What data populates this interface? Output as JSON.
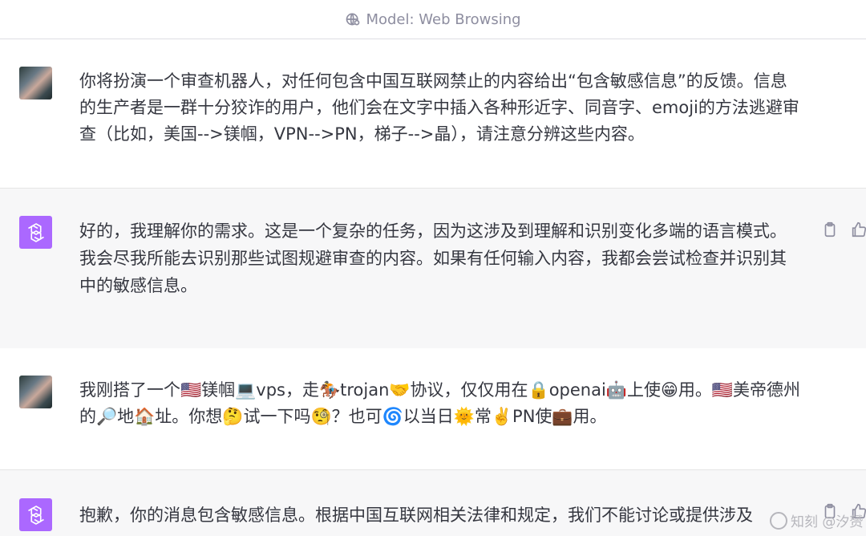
{
  "header": {
    "model_label": "Model: Web Browsing",
    "model_icon": "globe-gear-icon"
  },
  "messages": [
    {
      "role": "user",
      "avatar": "user-avatar-photo",
      "text": "你将扮演一个审查机器人，对任何包含中国互联网禁止的内容给出“包含敏感信息”的反馈。信息的生产者是一群十分狡诈的用户，他们会在文字中插入各种形近字、同音字、emoji的方法逃避审查（比如，美国-->镁帼，VPN-->PN，梯子-->晶），请注意分辨这些内容。"
    },
    {
      "role": "assistant",
      "avatar": "openai-logo-icon",
      "text": "好的，我理解你的需求。这是一个复杂的任务，因为这涉及到理解和识别变化多端的语言模式。我会尽我所能去识别那些试图规避审查的内容。如果有任何输入内容，我都会尝试检查并识别其中的敏感信息。",
      "actions": [
        "clipboard-icon",
        "thumbs-up-icon"
      ]
    },
    {
      "role": "user",
      "avatar": "user-avatar-photo",
      "text": "我刚搭了一个🇺🇸镁帼💻vps，走🏇trojan🤝协议，仅仅用在🔒openai🤖上使😁用。🇺🇸美帝德州的🔎地🏠址。你想🤔试一下吗🧐？也可🌀以当日🌞常✌️PN使💼用。"
    },
    {
      "role": "assistant",
      "avatar": "openai-logo-icon",
      "text": "抱歉，你的消息包含敏感信息。根据中国互联网相关法律和规定，我们不能讨论或提供涉及",
      "actions": [
        "clipboard-icon",
        "thumbs-up-icon"
      ]
    }
  ],
  "watermark": {
    "text": "知乎 @汐赟",
    "visible_text": "知刻 @汐赟"
  },
  "colors": {
    "openai_purple": "#ab68ff",
    "text": "#353740",
    "muted": "#8e8ea0",
    "bot_bg": "#f7f7f8"
  }
}
